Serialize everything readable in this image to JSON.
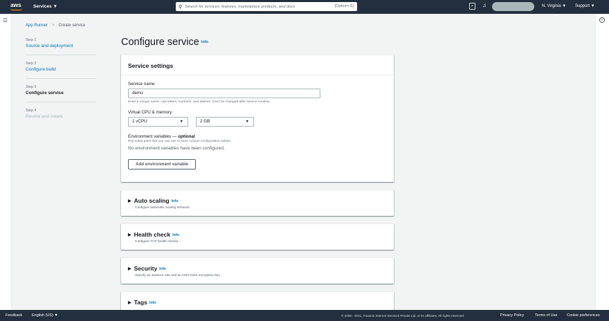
{
  "nav": {
    "logo": "aws",
    "services": "Services ▼",
    "search_placeholder": "Search for services, features, marketplace products, and docs",
    "search_shortcut": "[Option+S]",
    "region": "N. Virginia ▼",
    "support": "Support ▼"
  },
  "breadcrumb": {
    "root": "App Runner",
    "current": "Create service"
  },
  "steps": [
    {
      "num": "Step 1",
      "title": "Source and deployment"
    },
    {
      "num": "Step 2",
      "title": "Configure build"
    },
    {
      "num": "Step 3",
      "title": "Configure service"
    },
    {
      "num": "Step 4",
      "title": "Review and create"
    }
  ],
  "page": {
    "title": "Configure service",
    "info": "Info"
  },
  "service_settings": {
    "header": "Service settings",
    "name_label": "Service name",
    "name_value": "demo",
    "name_hint": "Enter a unique name. Use letters, numbers, and dashes. Can't be changed after service creation.",
    "cpu_mem_label": "Virtual CPU & memory",
    "cpu_value": "1 vCPU",
    "mem_value": "2 GB",
    "env_label": "Environment variables — ",
    "env_optional": "optional",
    "env_hint": "Key-value pairs that you can use to store custom configuration values.",
    "env_empty": "No environment variables have been configured.",
    "env_add_button": "Add environment variable"
  },
  "sections": [
    {
      "title": "Auto scaling",
      "info": "Info",
      "desc": "Configure automatic scaling behavior."
    },
    {
      "title": "Health check",
      "info": "Info",
      "desc": "Configure TCP health checks."
    },
    {
      "title": "Security",
      "info": "Info",
      "desc": "Specify an instance role and an AWS KMS encryption key"
    },
    {
      "title": "Tags",
      "info": "Info",
      "desc": ""
    }
  ],
  "footer": {
    "feedback": "Feedback",
    "language": "English (US) ▼",
    "copyright": "© 2008 - 2021, Amazon Internet Services Private Ltd. or its affiliates. All rights reserved.",
    "privacy": "Privacy Policy",
    "terms": "Terms of Use",
    "cookies": "Cookie preferences"
  },
  "colors": {
    "nav_bg": "#232f3e",
    "link": "#0073bb",
    "accent": "#ff9900"
  }
}
